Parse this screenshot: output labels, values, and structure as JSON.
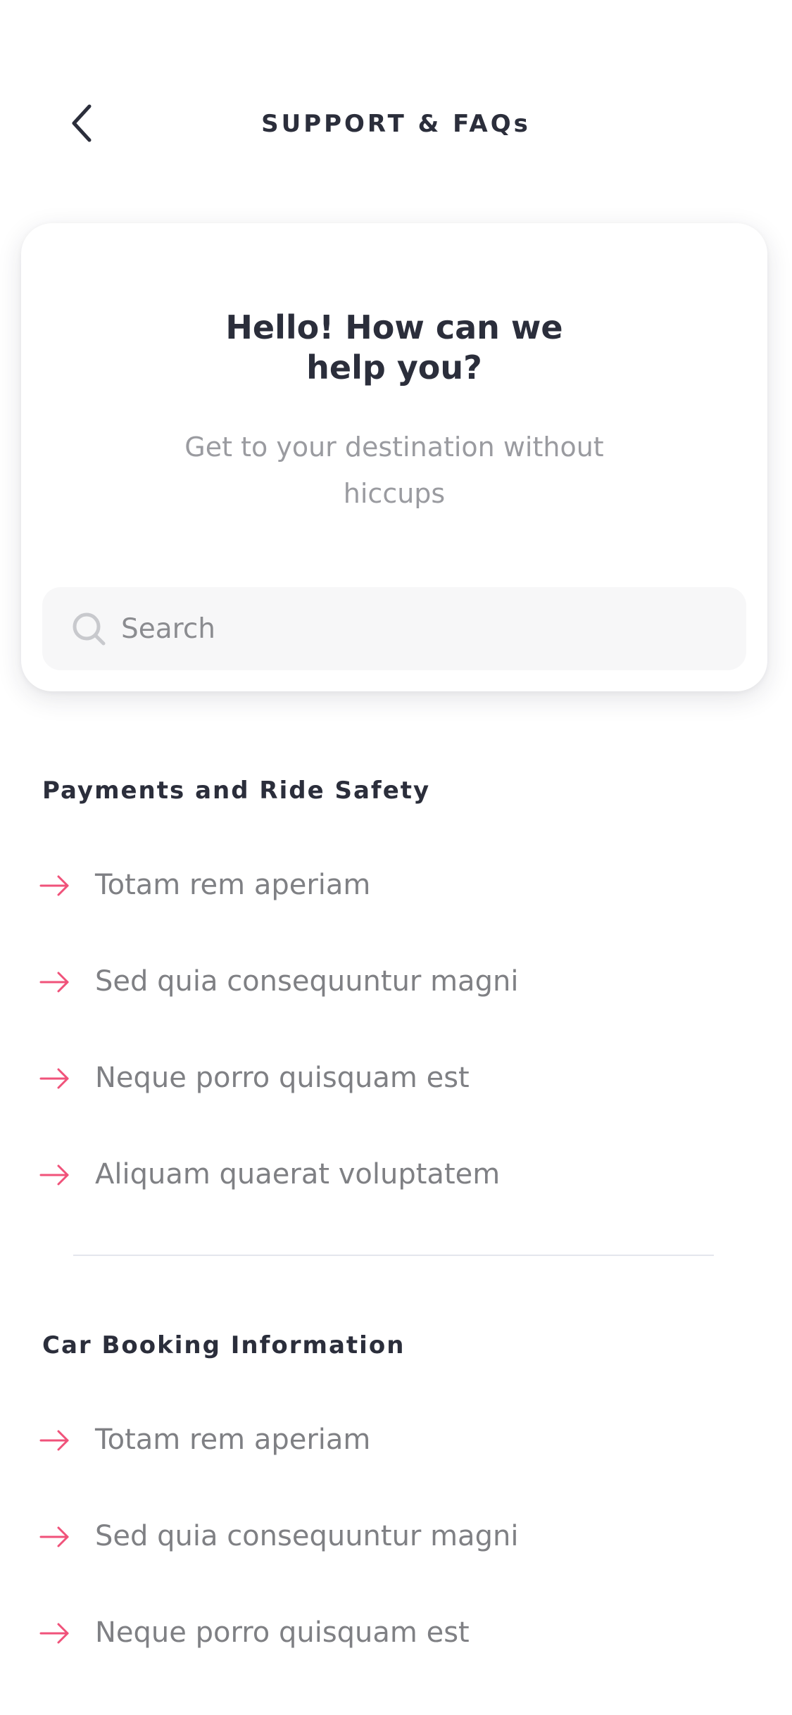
{
  "header": {
    "title": "SUPPORT & FAQs",
    "back_icon": "chevron-left-icon"
  },
  "hero": {
    "title_line1": "Hello! How can we",
    "title_line2": "help you?",
    "subtitle_line1": "Get to your destination without",
    "subtitle_line2": "hiccups"
  },
  "search": {
    "placeholder": "Search",
    "value": "",
    "icon": "search-icon"
  },
  "sections": [
    {
      "title": "Payments and Ride Safety",
      "items": [
        {
          "label": "Totam rem aperiam"
        },
        {
          "label": "Sed quia consequuntur magni"
        },
        {
          "label": "Neque porro quisquam est"
        },
        {
          "label": "Aliquam quaerat voluptatem"
        }
      ]
    },
    {
      "title": "Car Booking Information",
      "items": [
        {
          "label": "Totam rem aperiam"
        },
        {
          "label": "Sed quia consequuntur magni"
        },
        {
          "label": "Neque porro quisquam est"
        }
      ]
    }
  ],
  "colors": {
    "accent": "#f0527a",
    "text_dark": "#2b2e3b",
    "text_muted": "#7f8084",
    "search_bg": "#f7f7f8"
  },
  "item_icon": "arrow-right-icon"
}
